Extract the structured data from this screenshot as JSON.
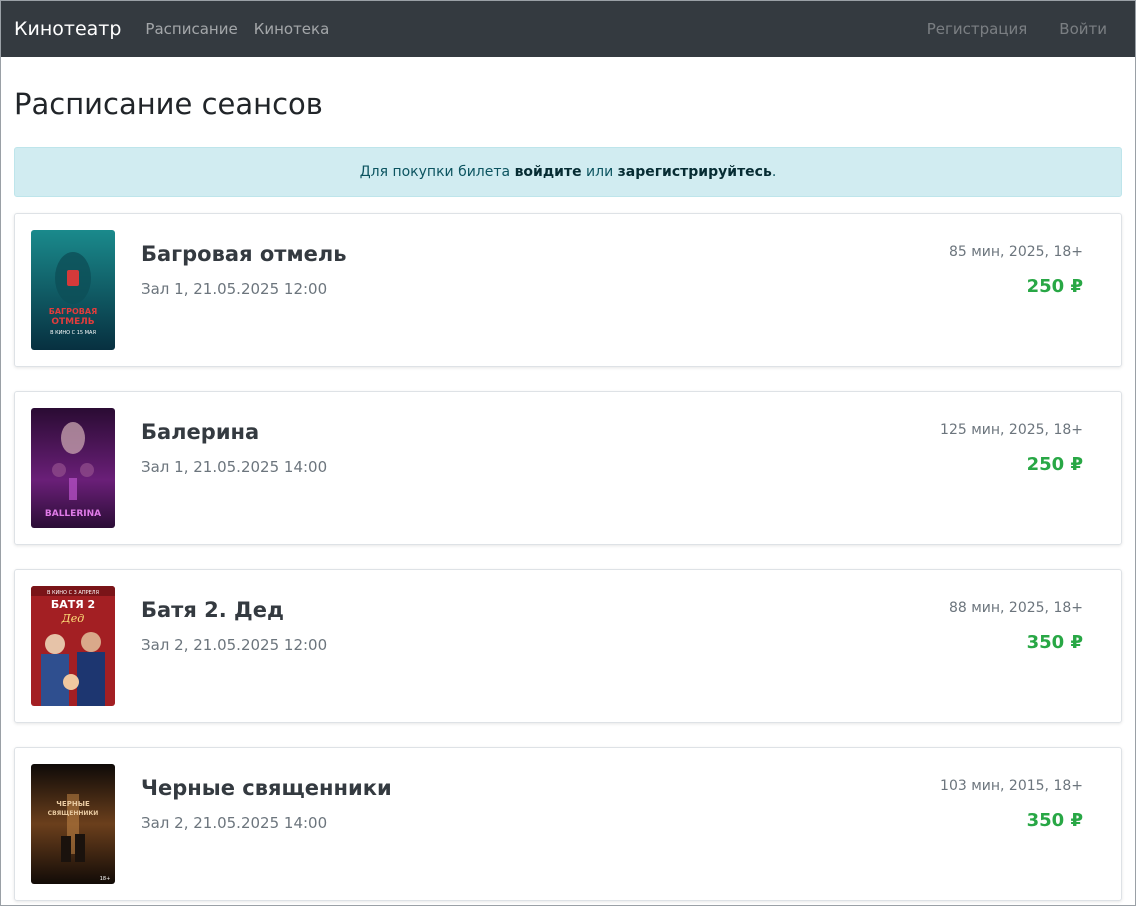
{
  "navbar": {
    "brand": "Кинотеатр",
    "links": [
      "Расписание",
      "Кинотека"
    ],
    "right_links": [
      "Регистрация",
      "Войти"
    ]
  },
  "page_title": "Расписание сеансов",
  "alert": {
    "prefix": "Для покупки билета ",
    "login": "войдите",
    "middle": " или ",
    "register": "зарегистрируйтесь",
    "suffix": "."
  },
  "sessions": [
    {
      "title": "Багровая отмель",
      "hall_time": "Зал 1, 21.05.2025 12:00",
      "specs": "85 мин, 2025, 18+",
      "price": "250 ₽",
      "poster_text": [
        "БАГРОВАЯ",
        "ОТМЕЛЬ",
        "В КИНО С 15 МАЯ"
      ],
      "poster_colors": [
        "#0f6e74",
        "#0a3a45"
      ]
    },
    {
      "title": "Балерина",
      "hall_time": "Зал 1, 21.05.2025 14:00",
      "specs": "125 мин, 2025, 18+",
      "price": "250 ₽",
      "poster_text": [
        "BALLERINA"
      ],
      "poster_colors": [
        "#3a1046",
        "#9b2fa0"
      ]
    },
    {
      "title": "Батя 2. Дед",
      "hall_time": "Зал 2, 21.05.2025 12:00",
      "specs": "88 мин, 2025, 18+",
      "price": "350 ₽",
      "poster_text": [
        "В КИНО С 3 АПРЕЛЯ",
        "БАТЯ 2",
        "Дед"
      ],
      "poster_colors": [
        "#9e1d1d",
        "#2a4f9a"
      ]
    },
    {
      "title": "Черные священники",
      "hall_time": "Зал 2, 21.05.2025 14:00",
      "specs": "103 мин, 2015, 18+",
      "price": "350 ₽",
      "poster_text": [
        "ЧЕРНЫЕ",
        "СВЯЩЕННИКИ",
        "18+"
      ],
      "poster_colors": [
        "#1a120d",
        "#7a4a1f"
      ]
    }
  ]
}
